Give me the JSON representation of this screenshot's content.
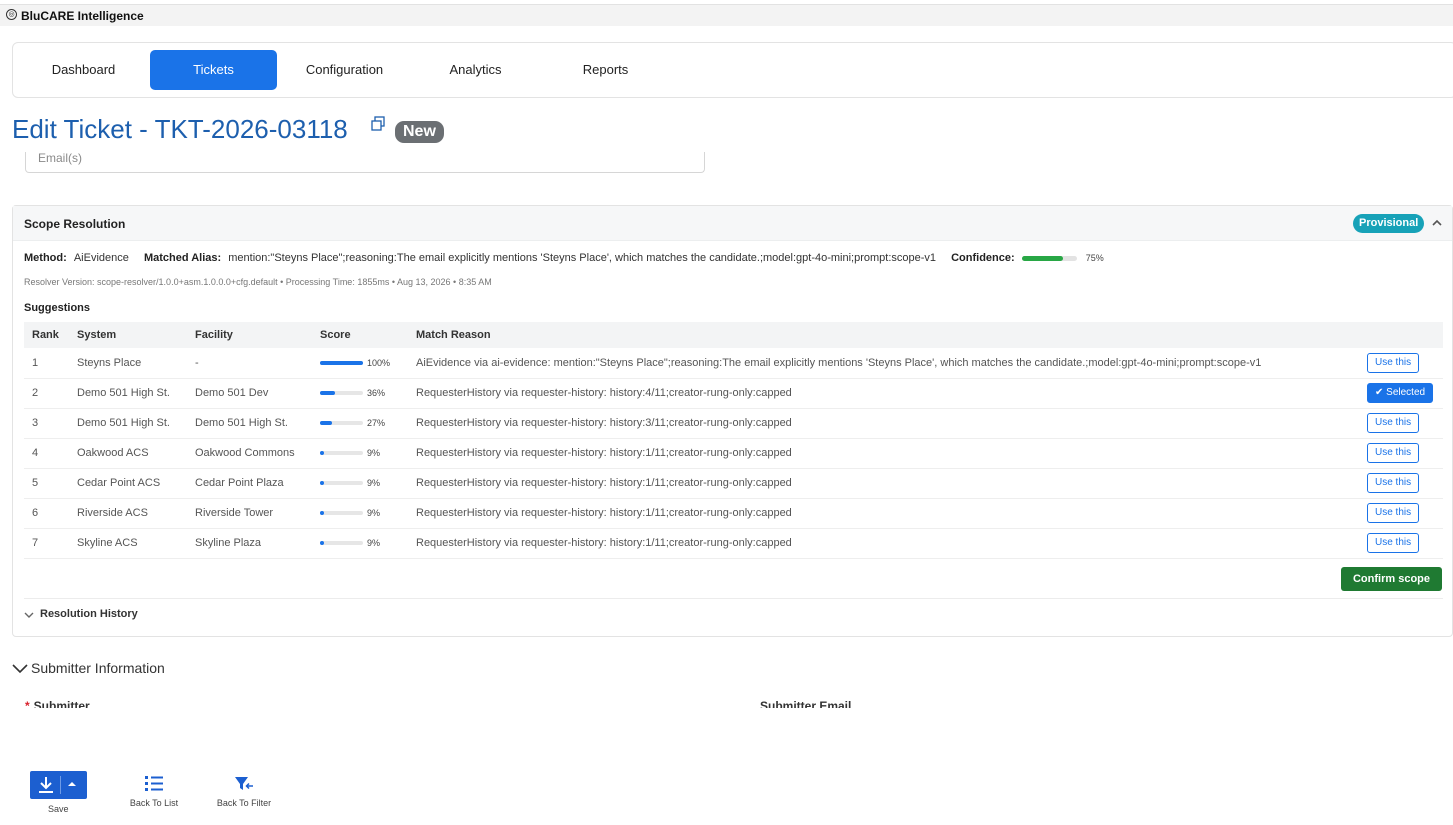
{
  "app": {
    "title": "BluCARE Intelligence"
  },
  "nav": {
    "tabs": [
      "Dashboard",
      "Tickets",
      "Configuration",
      "Analytics",
      "Reports"
    ],
    "active_tab": "Tickets"
  },
  "page": {
    "title": "Edit Ticket - TKT-2026-03118",
    "status": "New"
  },
  "email_field": {
    "placeholder": "Email(s)"
  },
  "scope": {
    "title": "Scope Resolution",
    "badge": "Provisional",
    "method_label": "Method:",
    "method_value": "AiEvidence",
    "alias_label": "Matched Alias:",
    "alias_value": "mention:\"Steyns Place\";reasoning:The email explicitly mentions 'Steyns Place', which matches the candidate.;model:gpt-4o-mini;prompt:scope-v1",
    "confidence_label": "Confidence:",
    "confidence_value": "75%",
    "confidence_fraction": 0.75,
    "resolver_info": "Resolver Version: scope-resolver/1.0.0+asm.1.0.0.0+cfg.default • Processing Time: 1855ms • Aug 13, 2026 • 8:35 AM",
    "suggestions_title": "Suggestions",
    "columns": [
      "Rank",
      "System",
      "Facility",
      "Score",
      "Match Reason"
    ],
    "rows": [
      {
        "rank": "1",
        "system": "Steyns Place",
        "facility": "-",
        "score": "100%",
        "score_fraction": 1.0,
        "reason": "AiEvidence via ai-evidence: mention:\"Steyns Place\";reasoning:The email explicitly mentions 'Steyns Place', which matches the candidate.;model:gpt-4o-mini;prompt:scope-v1",
        "action": "Use this",
        "selected": false
      },
      {
        "rank": "2",
        "system": "Demo 501 High St.",
        "facility": "Demo 501 Dev",
        "score": "36%",
        "score_fraction": 0.36,
        "reason": "RequesterHistory via requester-history: history:4/11;creator-rung-only:capped",
        "action": "Selected",
        "selected": true
      },
      {
        "rank": "3",
        "system": "Demo 501 High St.",
        "facility": "Demo 501 High St.",
        "score": "27%",
        "score_fraction": 0.27,
        "reason": "RequesterHistory via requester-history: history:3/11;creator-rung-only:capped",
        "action": "Use this",
        "selected": false
      },
      {
        "rank": "4",
        "system": "Oakwood ACS",
        "facility": "Oakwood Commons",
        "score": "9%",
        "score_fraction": 0.09,
        "reason": "RequesterHistory via requester-history: history:1/11;creator-rung-only:capped",
        "action": "Use this",
        "selected": false
      },
      {
        "rank": "5",
        "system": "Cedar Point ACS",
        "facility": "Cedar Point Plaza",
        "score": "9%",
        "score_fraction": 0.09,
        "reason": "RequesterHistory via requester-history: history:1/11;creator-rung-only:capped",
        "action": "Use this",
        "selected": false
      },
      {
        "rank": "6",
        "system": "Riverside ACS",
        "facility": "Riverside Tower",
        "score": "9%",
        "score_fraction": 0.09,
        "reason": "RequesterHistory via requester-history: history:1/11;creator-rung-only:capped",
        "action": "Use this",
        "selected": false
      },
      {
        "rank": "7",
        "system": "Skyline ACS",
        "facility": "Skyline Plaza",
        "score": "9%",
        "score_fraction": 0.09,
        "reason": "RequesterHistory via requester-history: history:1/11;creator-rung-only:capped",
        "action": "Use this",
        "selected": false
      }
    ],
    "confirm_label": "Confirm scope",
    "history_label": "Resolution History"
  },
  "submitter": {
    "section_title": "Submitter Information",
    "submitter_label": "Submitter",
    "email_label": "Submitter Email"
  },
  "toolbar": {
    "save_label": "Save",
    "back_list_label": "Back To List",
    "back_filter_label": "Back To Filter"
  },
  "colors": {
    "primary": "#1a73e8",
    "title_blue": "#1d5fae",
    "confirm_green": "#1f7a32",
    "provisional_teal": "#17a2b8",
    "confidence_green": "#28a745",
    "status_gray": "#6b6f73"
  }
}
